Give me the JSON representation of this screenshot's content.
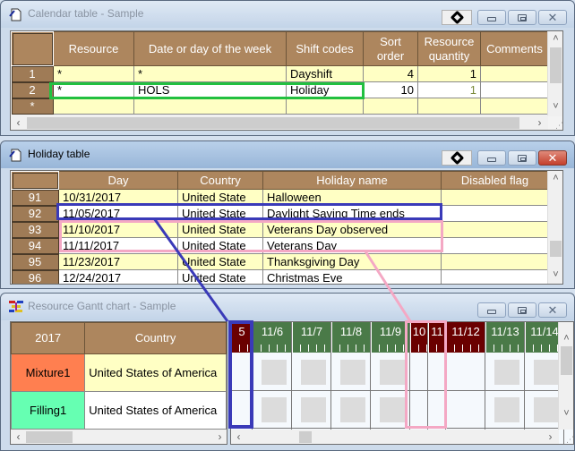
{
  "calendar_window": {
    "title": "Calendar table - Sample",
    "columns": [
      "Resource",
      "Date or day of the week",
      "Shift codes",
      "Sort order",
      "Resource quantity",
      "Comments"
    ],
    "rows": [
      {
        "row_header": "1",
        "resource": "*",
        "date": "*",
        "shift": "Dayshift",
        "sort": "4",
        "quantity": "1",
        "comments": ""
      },
      {
        "row_header": "2",
        "resource": "*",
        "date": "HOLS",
        "shift": "Holiday",
        "sort": "10",
        "quantity": "1",
        "comments": ""
      },
      {
        "row_header": "*",
        "resource": "",
        "date": "",
        "shift": "",
        "sort": "",
        "quantity": "",
        "comments": ""
      }
    ]
  },
  "holiday_window": {
    "title": "Holiday table",
    "columns": [
      "Day",
      "Country",
      "Holiday name",
      "Disabled flag"
    ],
    "rows": [
      {
        "row_header": "91",
        "day": "10/31/2017",
        "country": "United State",
        "name": "Halloween",
        "disabled": ""
      },
      {
        "row_header": "92",
        "day": "11/05/2017",
        "country": "United State",
        "name": "Daylight Saving Time ends",
        "disabled": ""
      },
      {
        "row_header": "93",
        "day": "11/10/2017",
        "country": "United State",
        "name": "Veterans Day observed",
        "disabled": ""
      },
      {
        "row_header": "94",
        "day": "11/11/2017",
        "country": "United State",
        "name": "Veterans Day",
        "disabled": ""
      },
      {
        "row_header": "95",
        "day": "11/23/2017",
        "country": "United State",
        "name": "Thanksgiving Day",
        "disabled": ""
      },
      {
        "row_header": "96",
        "day": "12/24/2017",
        "country": "United State",
        "name": "Christmas Eve",
        "disabled": ""
      }
    ]
  },
  "gantt_window": {
    "title": "Resource Gantt chart - Sample",
    "year_header": "2017",
    "country_header": "Country",
    "resources": [
      {
        "name": "Mixture1",
        "country": "United States of America",
        "color": "#ff7f50"
      },
      {
        "name": "Filling1",
        "country": "United States of America",
        "color": "#66ffb2"
      }
    ],
    "days": [
      {
        "label": "5",
        "type": "off"
      },
      {
        "label": "11/6",
        "type": "work"
      },
      {
        "label": "11/7",
        "type": "work"
      },
      {
        "label": "11/8",
        "type": "work"
      },
      {
        "label": "11/9",
        "type": "work"
      },
      {
        "label": "10",
        "type": "off"
      },
      {
        "label": "11",
        "type": "off"
      },
      {
        "label": "11/12",
        "type": "off"
      },
      {
        "label": "11/13",
        "type": "work"
      },
      {
        "label": "11/14",
        "type": "work"
      }
    ]
  },
  "colors": {
    "header_brown": "#ad865e",
    "highlight_green": "#22c040",
    "highlight_blue": "#3a3ab8",
    "highlight_pink": "#f4a8c4",
    "workday_green": "#4a7a48",
    "holiday_maroon": "#6a0000"
  }
}
